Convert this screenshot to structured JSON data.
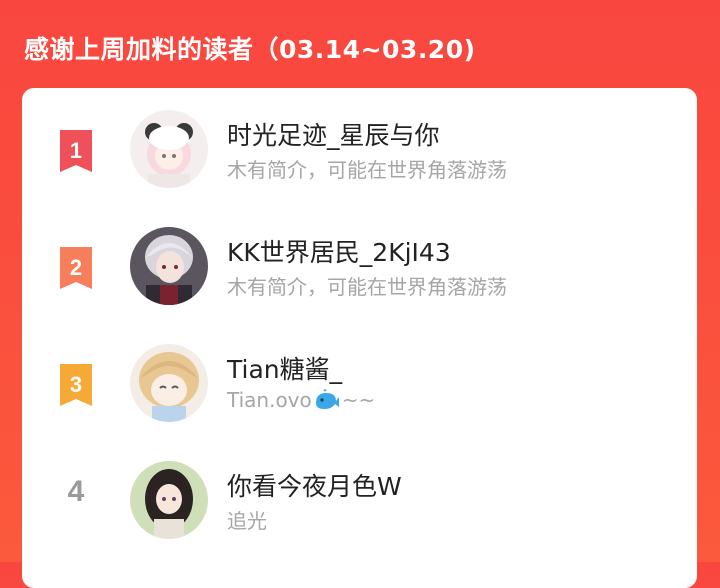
{
  "header": {
    "title": "感谢上周加料的读者（03.14~03.20)"
  },
  "colors": {
    "background": "#f9473f",
    "rank1": "#f0505a",
    "rank2": "#f77e5a",
    "rank3": "#f7a936",
    "rank_other": "#9a9a9a",
    "name_text": "#222222",
    "bio_text": "#a6a6a6"
  },
  "readers": [
    {
      "rank": "1",
      "name": "时光足迹_星辰与你",
      "bio": "木有简介，可能在世界角落游荡",
      "avatar_icon": "anime-girl-panda-hat-avatar"
    },
    {
      "rank": "2",
      "name": "KK世界居民_2KjI43",
      "bio": "木有简介，可能在世界角落游荡",
      "avatar_icon": "anime-boy-silver-hair-avatar"
    },
    {
      "rank": "3",
      "name": "Tian糖酱_",
      "bio": "Tian.ovo",
      "bio_suffix": "~~",
      "bio_emoji": "whale-icon",
      "avatar_icon": "anime-blonde-crying-avatar"
    },
    {
      "rank": "4",
      "name": "你看今夜月色W",
      "bio": "追光",
      "avatar_icon": "anime-dark-hair-girl-avatar"
    }
  ]
}
